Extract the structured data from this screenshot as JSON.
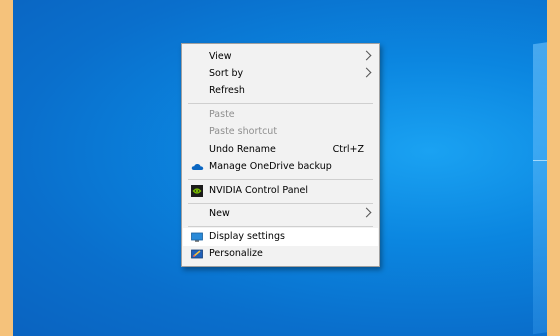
{
  "menu": {
    "view": "View",
    "sort_by": "Sort by",
    "refresh": "Refresh",
    "paste": "Paste",
    "paste_shortcut": "Paste shortcut",
    "undo_rename": "Undo Rename",
    "undo_shortcut": "Ctrl+Z",
    "onedrive_backup": "Manage OneDrive backup",
    "nvidia": "NVIDIA Control Panel",
    "new": "New",
    "display_settings": "Display settings",
    "personalize": "Personalize"
  },
  "icons": {
    "onedrive": "cloud-icon",
    "nvidia": "nvidia-icon",
    "display": "display-icon",
    "personalize": "personalize-icon"
  },
  "colors": {
    "desktop_blue": "#0b86e0",
    "frame_orange": "#f5c27b",
    "menu_bg": "#f2f2f2"
  }
}
